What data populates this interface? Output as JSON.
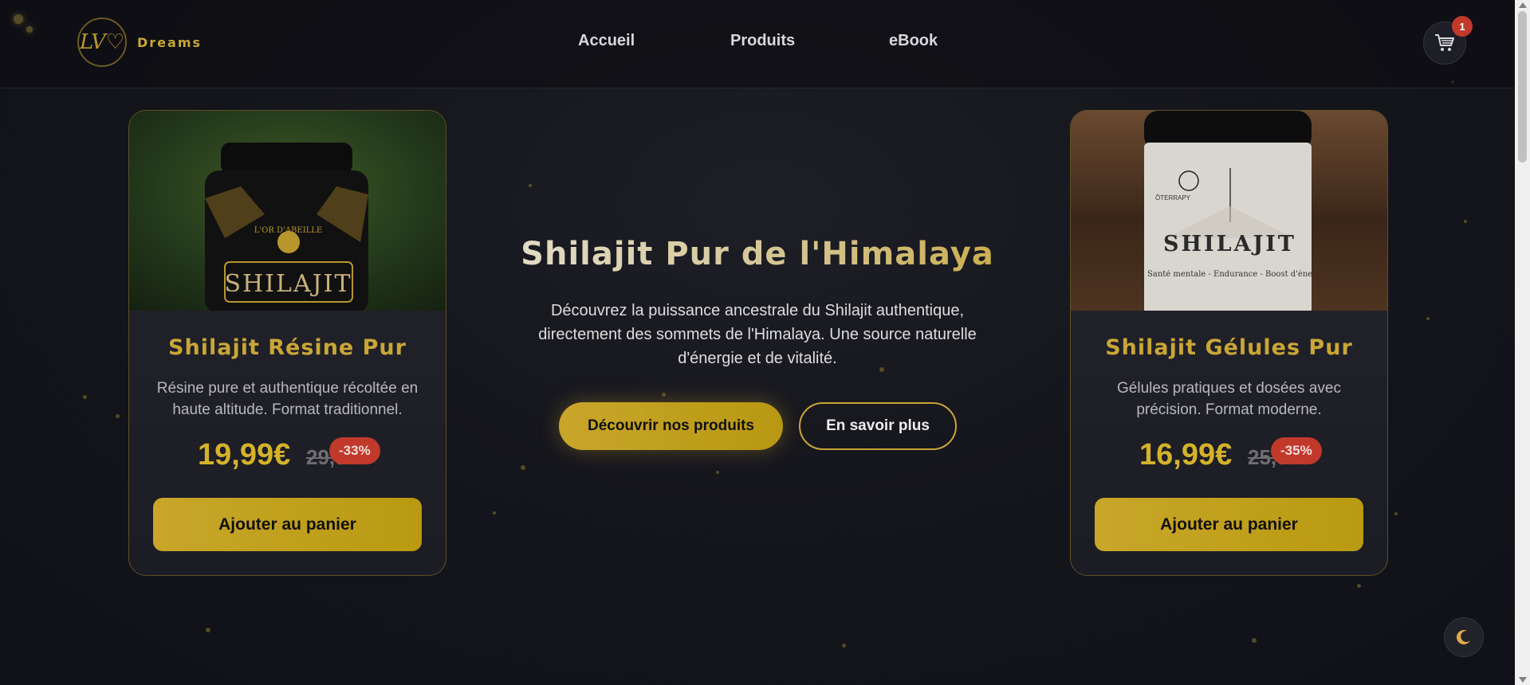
{
  "header": {
    "logo_text": "LV♡",
    "brand": "Dreams",
    "nav": [
      {
        "label": "Accueil"
      },
      {
        "label": "Produits"
      },
      {
        "label": "eBook"
      }
    ],
    "cart_count": "1"
  },
  "products": [
    {
      "image": "shilajit-resin-jar",
      "jar_label": "SHILAJIT",
      "jar_brand": "L'OR D'ABEILLE",
      "title": "Shilajit Résine Pur",
      "description": "Résine pure et authentique récoltée en haute altitude. Format traditionnel.",
      "price": "19,99€",
      "old_price": "29,99€",
      "discount": "-33%",
      "button": "Ajouter au panier"
    },
    {
      "image": "shilajit-capsules-bottle",
      "jar_label": "SHILAJIT",
      "jar_brand": "ÔTERRAPY",
      "jar_sub": "Santé mentale - Endurance - Boost d'énergie",
      "title": "Shilajit Gélules Pur",
      "description": "Gélules pratiques et dosées avec précision. Format moderne.",
      "price": "16,99€",
      "old_price": "25,99€",
      "discount": "-35%",
      "button": "Ajouter au panier"
    }
  ],
  "hero": {
    "title": "Shilajit Pur de l'Himalaya",
    "description": "Découvrez la puissance ancestrale du Shilajit authentique, directement des sommets de l'Himalaya. Une source naturelle d'énergie et de vitalité.",
    "primary_button": "Découvrir nos produits",
    "secondary_button": "En savoir plus"
  },
  "colors": {
    "accent": "#c9a636",
    "background": "#15151c",
    "discount": "#c0392b"
  }
}
